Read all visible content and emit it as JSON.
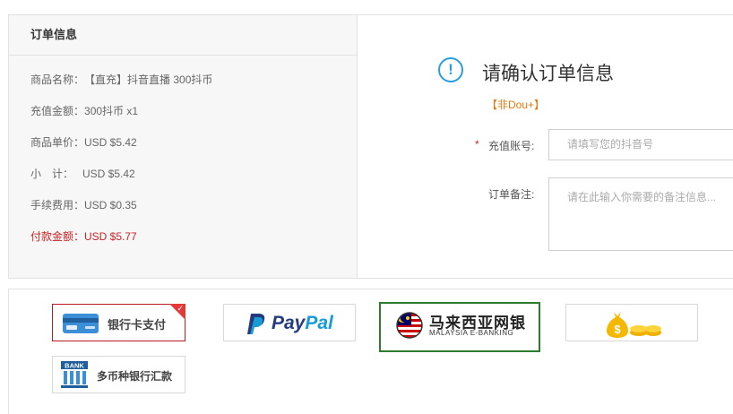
{
  "summary": {
    "title": "订单信息",
    "rows": [
      {
        "label": "商品名称：",
        "value": "【直充】抖音直播 300抖币"
      },
      {
        "label": "充值金额：",
        "value": "300抖币  x1"
      },
      {
        "label": "商品单价：",
        "value": "USD $5.42"
      },
      {
        "label": "小　计：",
        "value": "USD $5.42"
      },
      {
        "label": "手续费用：",
        "value": "USD $0.35"
      },
      {
        "label": "付款金额：",
        "value": "USD $5.77"
      }
    ]
  },
  "confirm": {
    "icon": "exclamation-icon",
    "icon_glyph": "!",
    "title": "请确认订单信息",
    "tag": "【非Dou+】",
    "required_mark": "*",
    "account_label": "充值账号:",
    "account_placeholder": "请填写您的抖音号",
    "remark_label": "订单备注:",
    "remark_placeholder": "请在此输入你需要的备注信息..."
  },
  "payment": {
    "options": [
      {
        "name": "银行卡支付",
        "icon": "bank-card-icon",
        "selected_style": "red-corner-check"
      },
      {
        "name": "PayPal",
        "name_part1": "Pay",
        "name_part2": "Pal",
        "icon": "paypal-icon"
      },
      {
        "name_cn": "马来西亚网银",
        "name_en": "MALAYSIA E-BANKING",
        "icon": "malaysia-flag-icon",
        "selected_style": "green-border"
      },
      {
        "icon": "money-bag-coins-icon"
      },
      {
        "name": "多币种银行汇款",
        "icon": "bank-building-icon",
        "icon_text": "BANK"
      }
    ]
  },
  "colors": {
    "accent_blue": "#2a9ee0",
    "total_red": "#cc2222",
    "tag_orange": "#e07a10",
    "selected_green": "#2e7d2e",
    "selected_red": "#b81c22"
  }
}
